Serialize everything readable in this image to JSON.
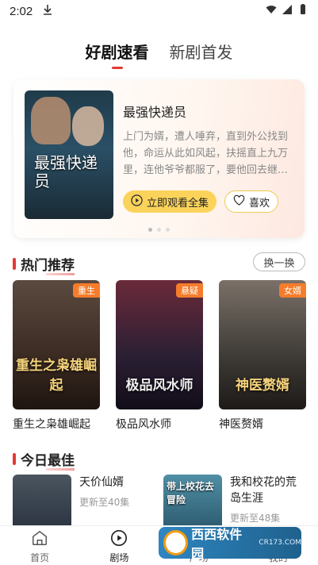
{
  "status_bar": {
    "time": "2:02"
  },
  "top_tabs": [
    {
      "label": "好剧速看",
      "active": true
    },
    {
      "label": "新剧首发",
      "active": false
    }
  ],
  "hero": {
    "poster_title": "最强快递员",
    "title": "最强快递员",
    "description": "上门为婿，遭人唾弃，直到外公找到他，命运从此如风起，扶摇直上九万里，连他爷爷都服了，要他回去继…",
    "watch_label": "立即观看全集",
    "like_label": "喜欢",
    "dots": 3,
    "active_dot": 0
  },
  "hot_section": {
    "title": "热门推荐",
    "refresh_label": "换一换",
    "items": [
      {
        "name": "重生之枭雄崛起",
        "tag": "重生",
        "art": "重生之枭雄崛起",
        "bg": "#3a2a22"
      },
      {
        "name": "极品风水师",
        "tag": "悬疑",
        "art": "极品风水师",
        "bg": "#2a1f33"
      },
      {
        "name": "神医赘婿",
        "tag": "女婿",
        "art": "神医赘婿",
        "bg": "#3d3a35"
      }
    ]
  },
  "today_section": {
    "title": "今日最佳",
    "items": [
      {
        "title": "天价仙婿",
        "sub": "更新至40集",
        "bg": "#2b3440"
      },
      {
        "title": "我和校花的荒岛生涯",
        "sub": "更新至48集",
        "art": "带上校花去冒险",
        "bg": "#2d5a6e"
      }
    ]
  },
  "bottom_nav": [
    {
      "label": "首页",
      "icon": "home-icon",
      "active": false
    },
    {
      "label": "剧场",
      "icon": "play-circle-icon",
      "active": true
    },
    {
      "label": "广场",
      "icon": "square-icon",
      "active": false
    },
    {
      "label": "我的",
      "icon": "user-icon",
      "active": false
    }
  ],
  "watermark": {
    "text": "西西软件园",
    "url": "CR173.COM"
  },
  "colors": {
    "accent": "#e53935",
    "watch_button": "#fbd35b",
    "tag": "#f57c2b"
  }
}
